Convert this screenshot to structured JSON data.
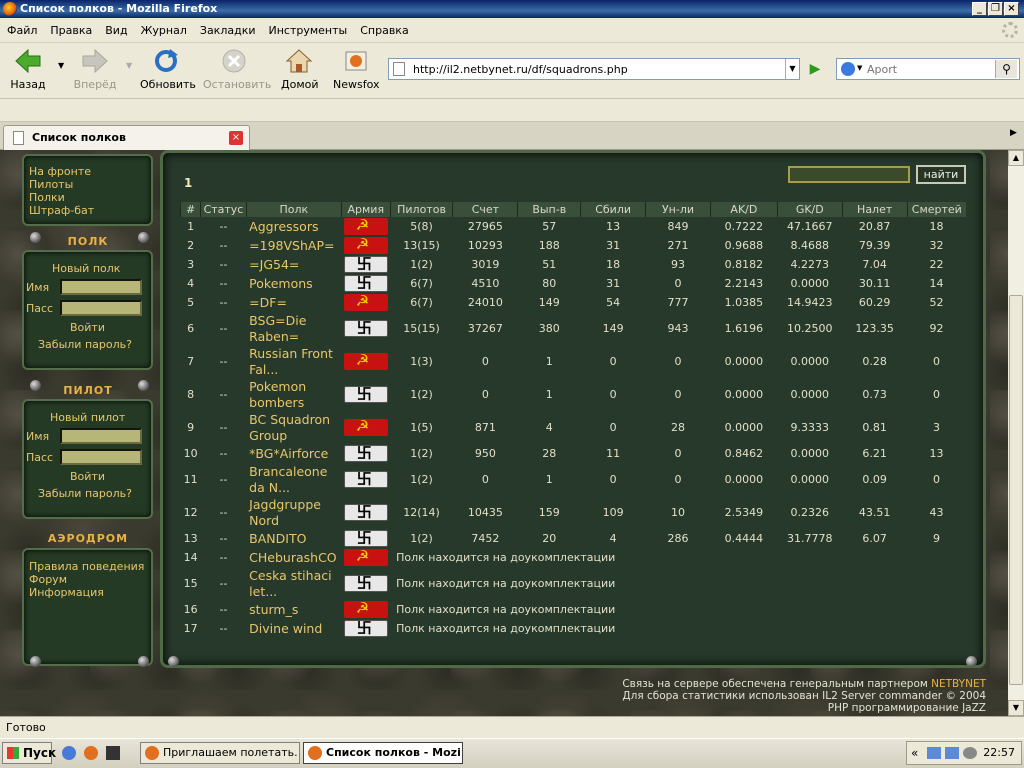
{
  "window": {
    "title": "Список полков - Mozilla Firefox"
  },
  "menu": [
    "Файл",
    "Правка",
    "Вид",
    "Журнал",
    "Закладки",
    "Инструменты",
    "Справка"
  ],
  "toolbar": {
    "back": "Назад",
    "forward": "Вперёд",
    "reload": "Обновить",
    "stop": "Остановить",
    "home": "Домой",
    "newsfox": "Newsfox"
  },
  "address": {
    "url": "http://il2.netbynet.ru/df/squadrons.php"
  },
  "search": {
    "placeholder": "Aport"
  },
  "tab": {
    "label": "Список полков"
  },
  "sidebar": {
    "nav": [
      "На фронте",
      "Пилоты",
      "Полки",
      "Штраф-бат"
    ],
    "squad_panel": {
      "heading": "ПОЛК",
      "new_label": "Новый полк",
      "name_label": "Имя",
      "pass_label": "Пасс",
      "login": "Войти",
      "forgot": "Забыли пароль?"
    },
    "pilot_panel": {
      "heading": "ПИЛОТ",
      "new_label": "Новый пилот",
      "name_label": "Имя",
      "pass_label": "Пасс",
      "login": "Войти",
      "forgot": "Забыли пароль?"
    },
    "airfield_panel": {
      "heading": "АЭРОДРОМ",
      "links": [
        "Правила поведения",
        "Форум",
        "Информация"
      ]
    }
  },
  "main": {
    "page": "1",
    "find_button": "найти",
    "columns": [
      "#",
      "Статус",
      "Полк",
      "Армия",
      "Пилотов",
      "Счет",
      "Вып-в",
      "Сбили",
      "Ун-ли",
      "AK/D",
      "GK/D",
      "Налет",
      "Смертей"
    ],
    "rows": [
      {
        "n": "1",
        "status": "--",
        "name": "Aggressors",
        "army": "ussr",
        "pilots": "5(8)",
        "score": "27965",
        "sorties": "57",
        "kills": "13",
        "gk": "849",
        "akd": "0.7222",
        "gkd": "47.1667",
        "flight": "20.87",
        "deaths": "18"
      },
      {
        "n": "2",
        "status": "--",
        "name": "=198VShAP=",
        "army": "ussr",
        "pilots": "13(15)",
        "score": "10293",
        "sorties": "188",
        "kills": "31",
        "gk": "271",
        "akd": "0.9688",
        "gkd": "8.4688",
        "flight": "79.39",
        "deaths": "32"
      },
      {
        "n": "3",
        "status": "--",
        "name": "=JG54=",
        "army": "ger",
        "pilots": "1(2)",
        "score": "3019",
        "sorties": "51",
        "kills": "18",
        "gk": "93",
        "akd": "0.8182",
        "gkd": "4.2273",
        "flight": "7.04",
        "deaths": "22"
      },
      {
        "n": "4",
        "status": "--",
        "name": "Pokemons",
        "army": "ger",
        "pilots": "6(7)",
        "score": "4510",
        "sorties": "80",
        "kills": "31",
        "gk": "0",
        "akd": "2.2143",
        "gkd": "0.0000",
        "flight": "30.11",
        "deaths": "14"
      },
      {
        "n": "5",
        "status": "--",
        "name": "=DF=",
        "army": "ussr",
        "pilots": "6(7)",
        "score": "24010",
        "sorties": "149",
        "kills": "54",
        "gk": "777",
        "akd": "1.0385",
        "gkd": "14.9423",
        "flight": "60.29",
        "deaths": "52"
      },
      {
        "n": "6",
        "status": "--",
        "name": "BSG=Die Raben=",
        "army": "ger",
        "pilots": "15(15)",
        "score": "37267",
        "sorties": "380",
        "kills": "149",
        "gk": "943",
        "akd": "1.6196",
        "gkd": "10.2500",
        "flight": "123.35",
        "deaths": "92"
      },
      {
        "n": "7",
        "status": "--",
        "name": "Russian Front Fal...",
        "army": "ussr",
        "pilots": "1(3)",
        "score": "0",
        "sorties": "1",
        "kills": "0",
        "gk": "0",
        "akd": "0.0000",
        "gkd": "0.0000",
        "flight": "0.28",
        "deaths": "0"
      },
      {
        "n": "8",
        "status": "--",
        "name": "Pokemon bombers",
        "army": "ger",
        "pilots": "1(2)",
        "score": "0",
        "sorties": "1",
        "kills": "0",
        "gk": "0",
        "akd": "0.0000",
        "gkd": "0.0000",
        "flight": "0.73",
        "deaths": "0"
      },
      {
        "n": "9",
        "status": "--",
        "name": "BC Squadron Group",
        "army": "ussr",
        "pilots": "1(5)",
        "score": "871",
        "sorties": "4",
        "kills": "0",
        "gk": "28",
        "akd": "0.0000",
        "gkd": "9.3333",
        "flight": "0.81",
        "deaths": "3"
      },
      {
        "n": "10",
        "status": "--",
        "name": "*BG*Airforce",
        "army": "ger",
        "pilots": "1(2)",
        "score": "950",
        "sorties": "28",
        "kills": "11",
        "gk": "0",
        "akd": "0.8462",
        "gkd": "0.0000",
        "flight": "6.21",
        "deaths": "13"
      },
      {
        "n": "11",
        "status": "--",
        "name": "Brancaleone da N...",
        "army": "ger",
        "pilots": "1(2)",
        "score": "0",
        "sorties": "1",
        "kills": "0",
        "gk": "0",
        "akd": "0.0000",
        "gkd": "0.0000",
        "flight": "0.09",
        "deaths": "0"
      },
      {
        "n": "12",
        "status": "--",
        "name": "Jagdgruppe Nord",
        "army": "ger",
        "pilots": "12(14)",
        "score": "10435",
        "sorties": "159",
        "kills": "109",
        "gk": "10",
        "akd": "2.5349",
        "gkd": "0.2326",
        "flight": "43.51",
        "deaths": "43"
      },
      {
        "n": "13",
        "status": "--",
        "name": "BANDITO",
        "army": "ger",
        "pilots": "1(2)",
        "score": "7452",
        "sorties": "20",
        "kills": "4",
        "gk": "286",
        "akd": "0.4444",
        "gkd": "31.7778",
        "flight": "6.07",
        "deaths": "9"
      },
      {
        "n": "14",
        "status": "--",
        "name": "CHeburashCO",
        "army": "ussr",
        "msg": "Полк находится на доукомплектации"
      },
      {
        "n": "15",
        "status": "--",
        "name": "Ceska stihaci let...",
        "army": "ger",
        "msg": "Полк находится на доукомплектации"
      },
      {
        "n": "16",
        "status": "--",
        "name": "sturm_s",
        "army": "ussr",
        "msg": "Полк находится на доукомплектации"
      },
      {
        "n": "17",
        "status": "--",
        "name": "Divine wind",
        "army": "ger",
        "msg": "Полк находится на доукомплектации"
      }
    ]
  },
  "footer": {
    "line1_text": "Связь на сервере обеспечена генеральным партнером ",
    "line1_link": "NETBYNET",
    "line2": "Для сбора статистики использован IL2 Server commander © 2004",
    "line3": "PHP программирование JaZZ"
  },
  "statusbar": {
    "text": "Готово"
  },
  "taskbar": {
    "start": "Пуск",
    "tasks": [
      "Приглашаем полетать. ...",
      "Список полков - Mozi..."
    ],
    "clock": "22:57"
  }
}
